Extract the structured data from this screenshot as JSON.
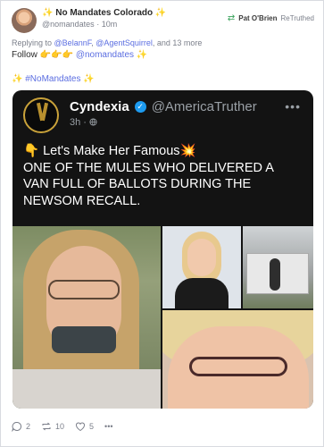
{
  "post": {
    "display_name": "✨ No Mandates Colorado ✨",
    "handle": "@nomandates",
    "separator": "·",
    "time": "10m",
    "retooted_by": "Pat O'Brien",
    "retooted_label": "ReTruthed",
    "replying_prefix": "Replying to",
    "replying_user1": "@BelannF",
    "replying_user2": "@AgentSquirrel",
    "replying_suffix": ", and 13 more",
    "follow_label": "Follow",
    "follow_emojis": "👉👉👉",
    "follow_handle": "@nomandates",
    "follow_sparkle": "✨",
    "hashtag": "✨ #NoMandates ✨"
  },
  "embed": {
    "name": "Cyndexia",
    "verified_mark": "✓",
    "handle": "@AmericaTruther",
    "time": "3h · ",
    "more": "•••",
    "text_line1": "👇 Let's Make Her Famous💥",
    "text_line2": "ONE OF THE MULES WHO DELIVERED A",
    "text_line3": "VAN FULL OF BALLOTS DURING THE",
    "text_line4": "NEWSOM RECALL.",
    "photo3_tag": ""
  },
  "actions": {
    "reply_count": "2",
    "retruth_count": "10",
    "like_count": "5",
    "more": "•••"
  },
  "colors": {
    "link": "#5b6ee1",
    "retruth_green": "#3aa35b",
    "embed_bg": "#131313",
    "verified": "#1d9bf0"
  }
}
